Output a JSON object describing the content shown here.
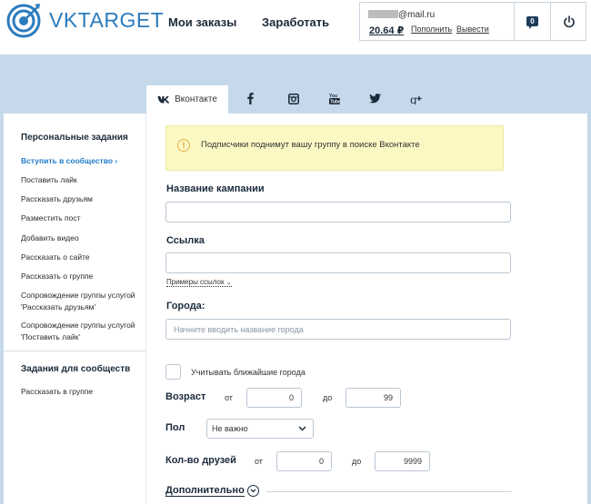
{
  "header": {
    "logo_text": "VKTARGET",
    "nav": [
      "Мои заказы",
      "Заработать"
    ],
    "account": {
      "email_suffix": "@mail.ru",
      "balance": "20.64 ₽",
      "topup": "Пополнить",
      "withdraw": "Вывести",
      "messages_count": "0"
    }
  },
  "tabs": {
    "active_label": "Вконтакте",
    "icons": [
      "facebook-icon",
      "instagram-icon",
      "youtube-icon",
      "twitter-icon",
      "google-plus-icon"
    ]
  },
  "sidebar": {
    "section1_title": "Персональные задания",
    "items": [
      "Вступить в сообщество",
      "Поставить лайк",
      "Рассказать друзьям",
      "Разместить пост",
      "Добавить видео",
      "Рассказать о сайте",
      "Рассказать о группе",
      "Сопровождение группы услугой 'Рассказать друзьям'",
      "Сопровождение группы услугой 'Поставить лайк'"
    ],
    "section2_title": "Задания для сообществ",
    "items2": [
      "Рассказать в группе"
    ]
  },
  "form": {
    "notice": "Подписчики поднимут вашу группу в поиске Вконтакте",
    "campaign_label": "Название кампании",
    "campaign_value": "",
    "link_label": "Ссылка",
    "link_value": "",
    "examples": "Примеры ссылок",
    "cities_label": "Города:",
    "cities_placeholder": "Начните вводить название города",
    "nearby_label": "Учитывать ближайшие города",
    "age_label": "Возраст",
    "from": "от",
    "to": "до",
    "age_from": "0",
    "age_to": "99",
    "gender_label": "Пол",
    "gender_value": "Не важно",
    "friends_label": "Кол-во друзей",
    "friends_from": "0",
    "friends_to": "9999",
    "more": "Дополнительно"
  },
  "colors": {
    "brand": "#2b7bbd",
    "band": "#c5d9eb",
    "active_link": "#1f7ac9",
    "notice_bg": "#fcf8c4"
  }
}
